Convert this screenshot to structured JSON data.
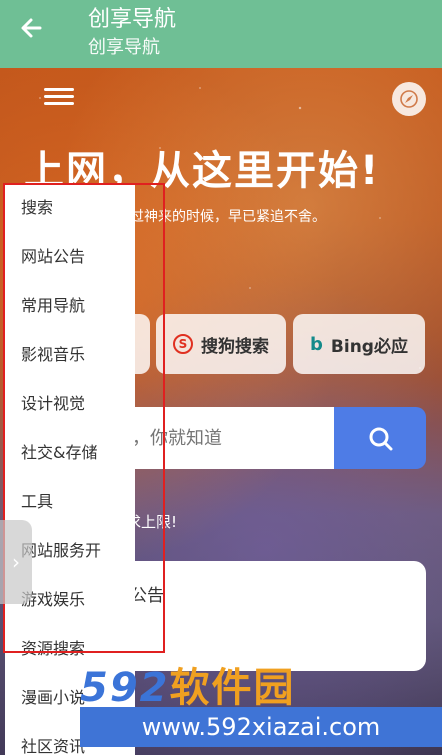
{
  "appbar": {
    "title": "创享导航",
    "subtitle": "创享导航",
    "back_icon": "arrow-left-icon"
  },
  "hero": {
    "title": "上网，从这里开始!",
    "tagline": "过神来的时候，早已紧追不舍。"
  },
  "engines": [
    {
      "label": "",
      "icon": "partial-engine-icon"
    },
    {
      "label": "搜狗搜索",
      "icon": "sogou-icon",
      "glyph": "S"
    },
    {
      "label": "Bing必应",
      "icon": "bing-icon",
      "glyph": "b"
    }
  ],
  "search": {
    "placeholder": "，你就知道"
  },
  "upper_limit_text": "求上限!",
  "notice_title": "公告",
  "drawer": {
    "items": [
      "搜索",
      "网站公告",
      "常用导航",
      "影视音乐",
      "设计视觉",
      "社交&存储",
      "工具",
      "网站服务开",
      "游戏娱乐",
      "资源搜索",
      "漫画小说",
      "社区资讯"
    ]
  },
  "watermark": {
    "logo_digits": "592",
    "logo_cn": "软件园",
    "url": "www.592xiazai.com"
  },
  "colors": {
    "appbar": "#6fbf95",
    "search_button": "#4e7ce6",
    "highlight": "#e02020",
    "watermark": "#3f74d6"
  }
}
